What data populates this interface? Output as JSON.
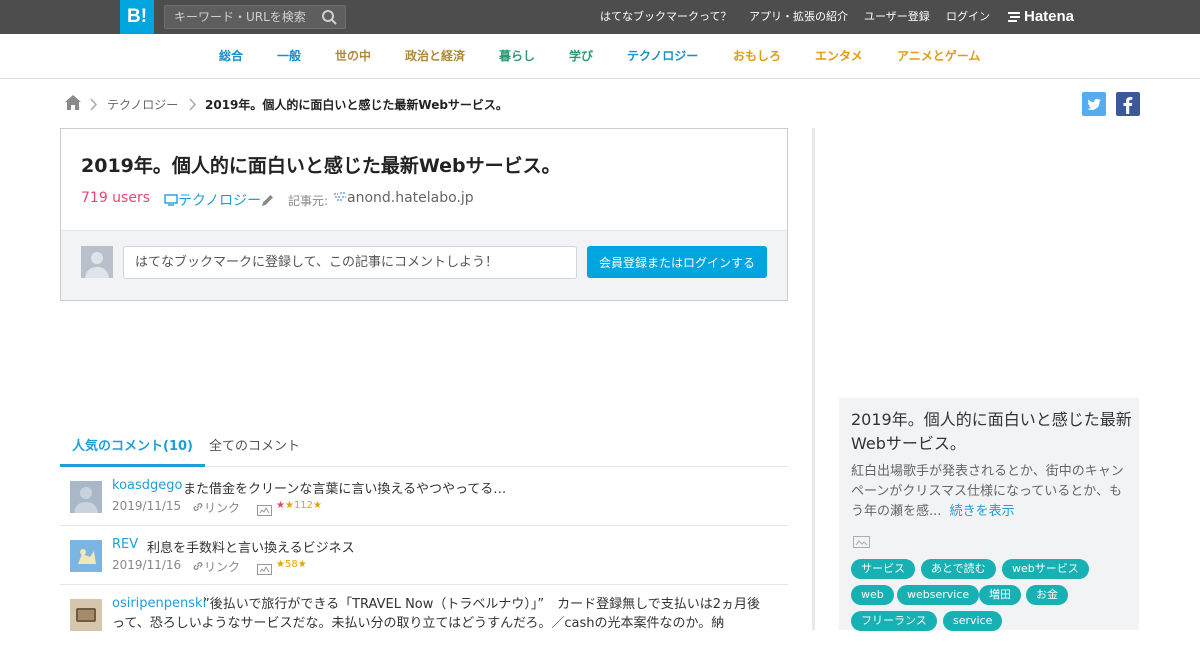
{
  "topbar": {
    "logo": "B!",
    "search_placeholder": "キーワード・URLを検索",
    "nav": [
      "はてなブックマークって？",
      "アプリ・拡張の紹介",
      "ユーザー登録",
      "ログイン"
    ],
    "brand": "Hatena"
  },
  "categories": [
    {
      "label": "総合",
      "color": "#1a90c8"
    },
    {
      "label": "一般",
      "color": "#1a90c8"
    },
    {
      "label": "世の中",
      "color": "#b08a3a"
    },
    {
      "label": "政治と経済",
      "color": "#b08a3a"
    },
    {
      "label": "暮らし",
      "color": "#2a9b73"
    },
    {
      "label": "学び",
      "color": "#2a9b73"
    },
    {
      "label": "テクノロジー",
      "color": "#1a90c8"
    },
    {
      "label": "おもしろ",
      "color": "#e09b10"
    },
    {
      "label": "エンタメ",
      "color": "#e09b10"
    },
    {
      "label": "アニメとゲーム",
      "color": "#e09b10"
    }
  ],
  "breadcrumb": {
    "category": "テクノロジー",
    "current": "2019年。個人的に面白いと感じた最新Webサービス。"
  },
  "entry": {
    "title": "2019年。個人的に面白いと感じた最新Webサービス。",
    "users": "719 users",
    "category": "テクノロジー",
    "source_label": "記事元:",
    "source": "anond.hatelabo.jp",
    "comment_placeholder": "はてなブックマークに登録して、この記事にコメントしよう！",
    "login_button": "会員登録またはログインする"
  },
  "tabs": [
    "人気のコメント(10)",
    "全てのコメント"
  ],
  "comments": [
    {
      "user": "koasdgego",
      "text": "また借金をクリーンな言葉に言い換えるやつやってる…",
      "date": "2019/11/15",
      "link": "リンク",
      "stars": "112"
    },
    {
      "user": "REV",
      "text": "利息を手数料と言い換えるビジネス",
      "date": "2019/11/16",
      "link": "リンク",
      "stars": "58"
    },
    {
      "user": "osiripenpenski",
      "text": "”後払いで旅行ができる「TRAVEL Now（トラベルナウ）」”　カード登録無しで支払いは2ヵ月後って、恐ろしいようなサービスだな。未払い分の取り立てはどうすんだろ。／cashの光本案件なのか。納"
    }
  ],
  "sidebar": {
    "title": "2019年。個人的に面白いと感じた最新Webサービス。",
    "desc": "紅白出場歌手が発表されるとか、街中のキャンペーンがクリスマス仕様になっているとか、もう年の瀬を感...",
    "more": "続きを表示",
    "tags": [
      "サービス",
      "あとで読む",
      "webサービス",
      "web",
      "webservice",
      "増田",
      "お金",
      "フリーランス",
      "service"
    ]
  },
  "colors": {
    "accent": "#00a4de",
    "users": "#e8466e",
    "tag": "#17b1b4",
    "topbar": "#4d4d4d"
  }
}
